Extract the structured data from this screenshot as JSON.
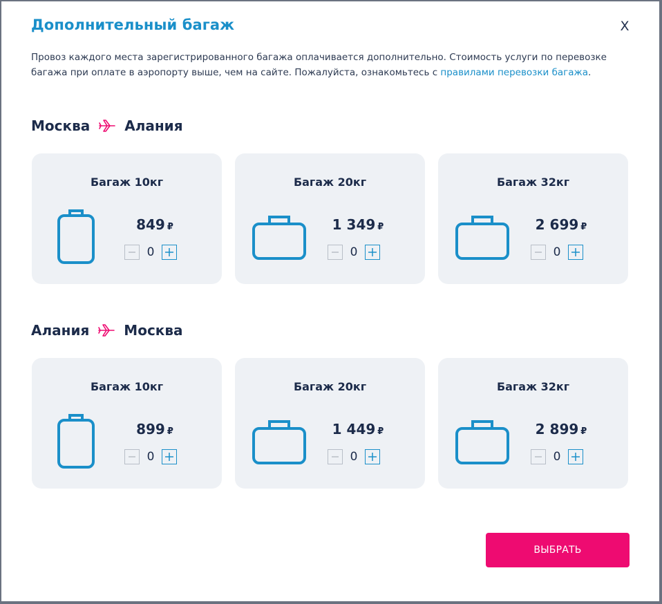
{
  "modal": {
    "title": "Дополнительный багаж",
    "close_label": "X",
    "description_text": "Провоз каждого места зарегистрированного багажа оплачивается дополнительно. Стоимость услуги по перевозке багажа при оплате в аэропорту выше, чем на сайте. Пожалуйста, ознакомьтесь с ",
    "description_link": "правилами перевозки багажа",
    "description_end": "."
  },
  "segments": [
    {
      "from": "Москва",
      "to": "Алания",
      "options": [
        {
          "title": "Багаж 10кг",
          "price": "849",
          "currency": "₽",
          "quantity": "0",
          "icon": "carry-on-bag-icon"
        },
        {
          "title": "Багаж 20кг",
          "price": "1 349",
          "currency": "₽",
          "quantity": "0",
          "icon": "suitcase-icon"
        },
        {
          "title": "Багаж 32кг",
          "price": "2 699",
          "currency": "₽",
          "quantity": "0",
          "icon": "suitcase-icon"
        }
      ]
    },
    {
      "from": "Алания",
      "to": "Москва",
      "options": [
        {
          "title": "Багаж 10кг",
          "price": "899",
          "currency": "₽",
          "quantity": "0",
          "icon": "carry-on-bag-icon"
        },
        {
          "title": "Багаж 20кг",
          "price": "1 449",
          "currency": "₽",
          "quantity": "0",
          "icon": "suitcase-icon"
        },
        {
          "title": "Багаж 32кг",
          "price": "2 899",
          "currency": "₽",
          "quantity": "0",
          "icon": "suitcase-icon"
        }
      ]
    }
  ],
  "actions": {
    "select_label": "ВЫБРАТЬ"
  },
  "colors": {
    "accent": "#1a8fc9",
    "brand_pink": "#ee0b71",
    "card_bg": "#eef1f5",
    "text_dark": "#1c2b4a"
  }
}
